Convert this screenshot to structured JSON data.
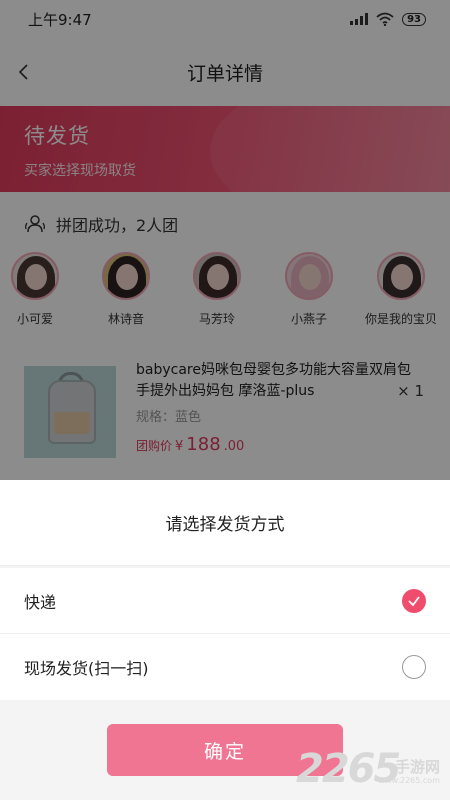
{
  "status_bar": {
    "time": "上午9:47",
    "battery": "93"
  },
  "nav": {
    "title": "订单详情",
    "back_icon": "chevron-left-icon"
  },
  "banner": {
    "title": "待发货",
    "subtitle": "买家选择现场取货",
    "gradient_from": "#e13b5f",
    "gradient_to": "#f47f96"
  },
  "group": {
    "text": "拼团成功，2人团",
    "icon": "group-users-icon"
  },
  "members": [
    {
      "name": "小可爱"
    },
    {
      "name": "林诗音"
    },
    {
      "name": "马芳玲"
    },
    {
      "name": "小燕子"
    },
    {
      "name": "你是我的宝贝"
    }
  ],
  "product": {
    "title": "babycare妈咪包母婴包多功能大容量双肩包手提外出妈妈包 摩洛蓝-plus",
    "quantity": "× 1",
    "spec": "规格：蓝色",
    "price_label": "团购价",
    "currency": "¥",
    "price_main": "188",
    "price_decimal": ".00",
    "price_color": "#e13b5f"
  },
  "sheet": {
    "title": "请选择发货方式",
    "options": [
      {
        "label": "快递",
        "selected": true
      },
      {
        "label": "现场发货(扫一扫)",
        "selected": false
      }
    ],
    "confirm_label": "确定",
    "accent_color": "#f04c6e"
  },
  "watermark": {
    "digits": "2265",
    "text": "手游网",
    "url": "www.2265.com"
  }
}
